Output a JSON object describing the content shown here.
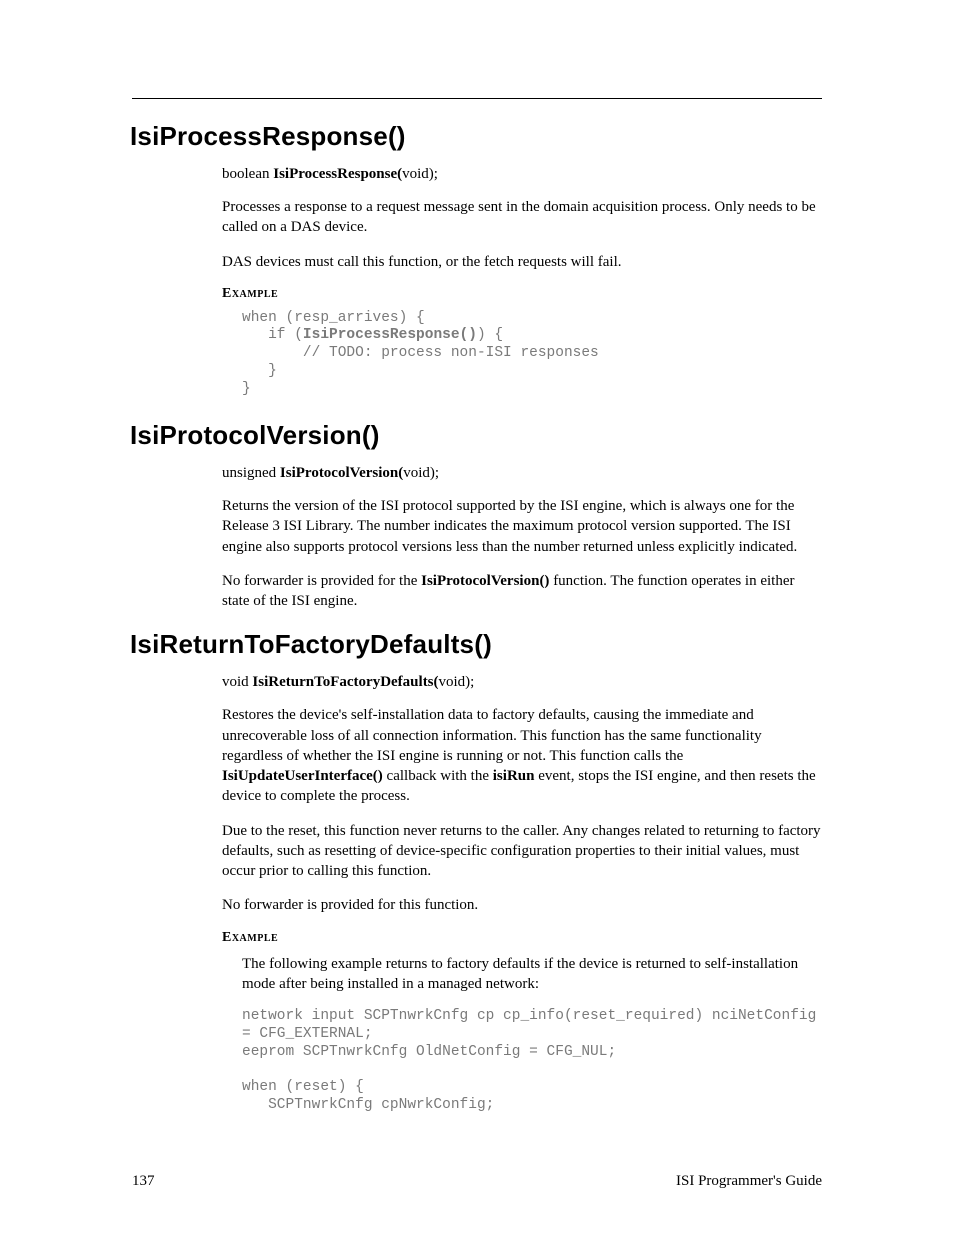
{
  "sections": {
    "s1": {
      "heading": "IsiProcessResponse()",
      "sig_prefix": "boolean ",
      "sig_name": "IsiProcessResponse(",
      "sig_suffix": "void);",
      "p1": "Processes a response to a request message sent in the domain acquisition process. Only needs to be called on a DAS device.",
      "p2": "DAS devices must call this function, or the fetch requests will fail.",
      "example_label": "Example",
      "code_a": "when (resp_arrives) {\n   if (",
      "code_bold": "IsiProcessResponse()",
      "code_b": ") {\n       // TODO: process non-ISI responses\n   }\n}"
    },
    "s2": {
      "heading": "IsiProtocolVersion()",
      "sig_prefix": "unsigned ",
      "sig_name": "IsiProtocolVersion(",
      "sig_suffix": "void);",
      "p1": "Returns the version of the ISI protocol supported by the ISI engine, which is always one for the Release 3 ISI Library.  The number indicates the maximum protocol version supported.  The ISI engine also supports protocol versions less than the number returned unless explicitly indicated.",
      "p2a": "No forwarder is provided for the ",
      "p2_bold": "IsiProtocolVersion()",
      "p2b": " function.  The function operates in either state of the ISI engine."
    },
    "s3": {
      "heading": "IsiReturnToFactoryDefaults()",
      "sig_prefix": "void ",
      "sig_name": "IsiReturnToFactoryDefaults(",
      "sig_suffix": "void);",
      "p1a": "Restores the device's self-installation data to factory defaults, causing the immediate and unrecoverable loss of all connection information.  This function has the same functionality regardless of whether the ISI engine is running or not. This function calls the ",
      "p1_bold1": "IsiUpdateUserInterface()",
      "p1b": " callback with the ",
      "p1_bold2": "isiRun",
      "p1c": " event, stops the ISI engine, and then resets the device to complete the process.",
      "p2": "Due to the reset, this function never returns to the caller.  Any changes related to returning to factory defaults, such as resetting of device-specific configuration properties to their initial values, must occur prior to calling this function.",
      "p3": "No forwarder is provided for this function.",
      "example_label": "Example",
      "example_intro": "The following example returns to factory defaults if the device is returned to self-installation mode after being installed in a managed network:",
      "code": "network input SCPTnwrkCnfg cp cp_info(reset_required) nciNetConfig\n= CFG_EXTERNAL;\neeprom SCPTnwrkCnfg OldNetConfig = CFG_NUL;\n\nwhen (reset) {\n   SCPTnwrkCnfg cpNwrkConfig;"
    }
  },
  "footer": {
    "page": "137",
    "title": "ISI Programmer's Guide"
  }
}
